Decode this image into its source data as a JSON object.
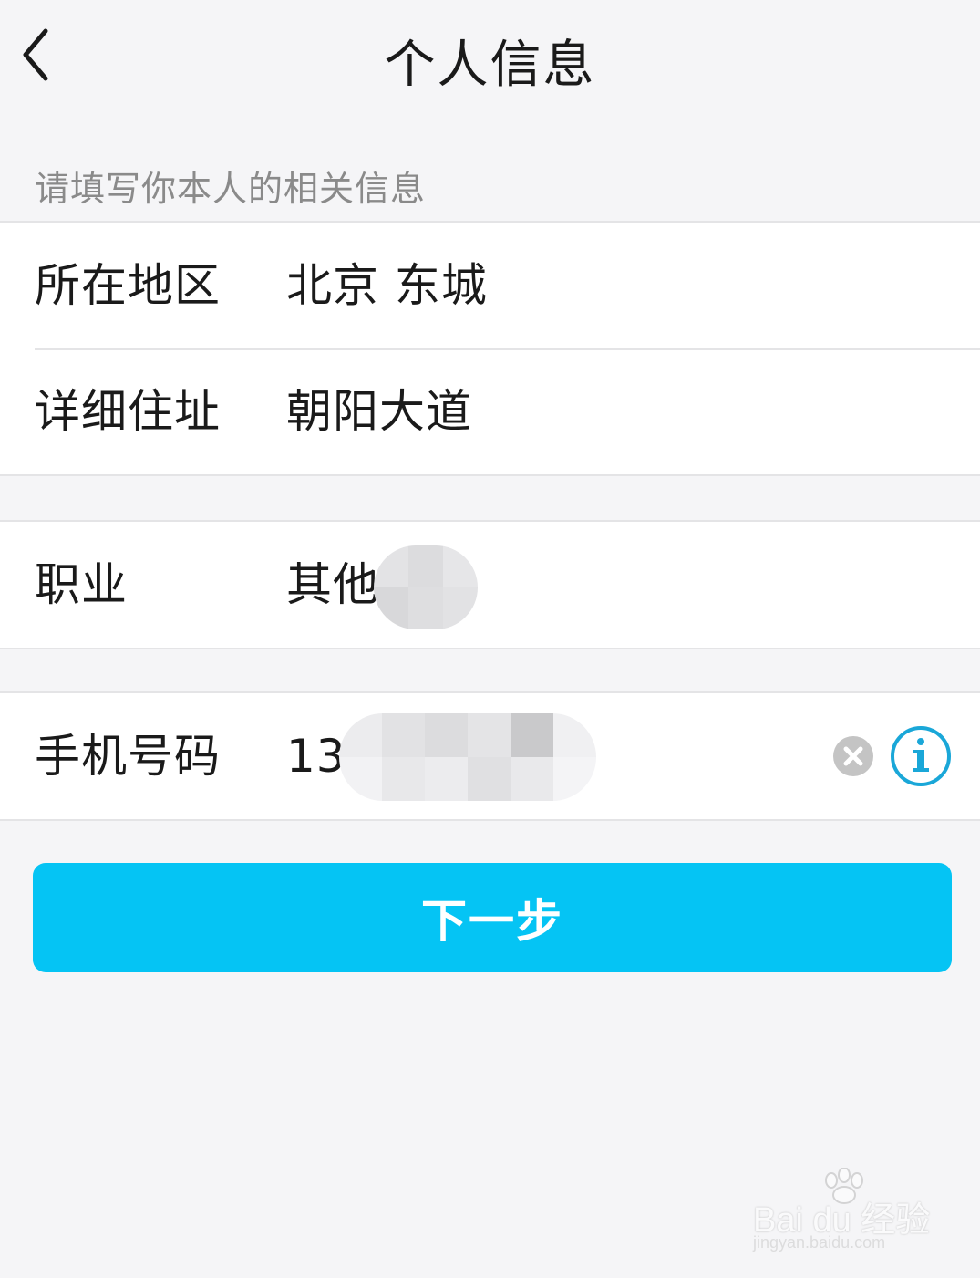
{
  "header": {
    "title": "个人信息"
  },
  "hint": "请填写你本人的相关信息",
  "address_group": {
    "region": {
      "label": "所在地区",
      "value": "北京 东城"
    },
    "detail": {
      "label": "详细住址",
      "value": "朝阳大道"
    }
  },
  "job": {
    "label": "职业",
    "value": "其他"
  },
  "phone": {
    "label": "手机号码",
    "value": "13"
  },
  "next_button": {
    "label": "下一步"
  },
  "watermark": {
    "brand": "Bai du 经验",
    "url": "jingyan.baidu.com"
  },
  "colors": {
    "background": "#f5f5f7",
    "accent": "#05c4f4",
    "info_icon": "#1aa7d8",
    "text": "#1a1a1a",
    "hint": "#8a8a8a"
  },
  "icons": [
    "back-arrow-icon",
    "clear-icon",
    "info-icon",
    "baidu-paw-icon"
  ]
}
